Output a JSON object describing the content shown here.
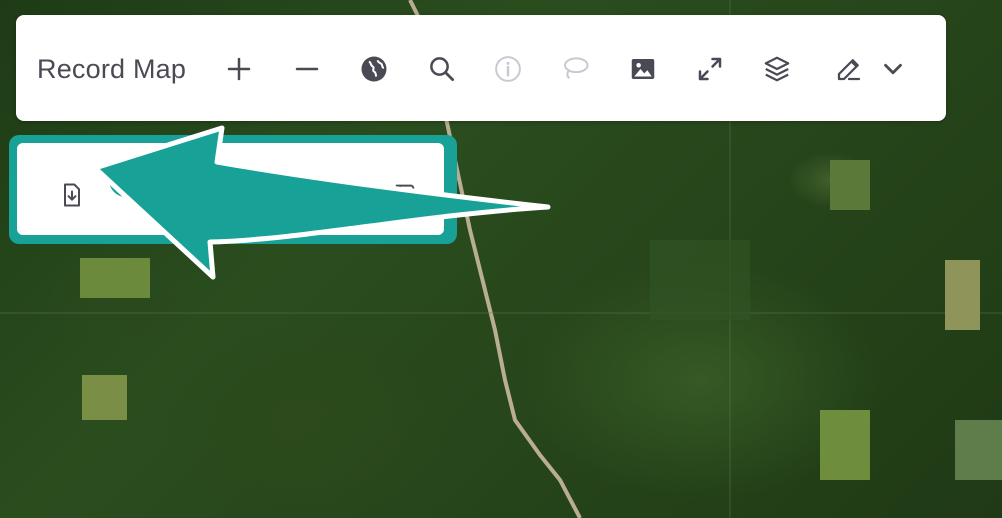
{
  "toolbar": {
    "title": "Record Map",
    "buttons": [
      {
        "name": "zoom-in",
        "icon": "plus-icon",
        "enabled": true
      },
      {
        "name": "zoom-out",
        "icon": "minus-icon",
        "enabled": true
      },
      {
        "name": "globe",
        "icon": "globe-icon",
        "enabled": true
      },
      {
        "name": "search",
        "icon": "search-icon",
        "enabled": true
      },
      {
        "name": "info",
        "icon": "info-icon",
        "enabled": false
      },
      {
        "name": "lasso",
        "icon": "lasso-icon",
        "enabled": false
      },
      {
        "name": "image",
        "icon": "image-icon",
        "enabled": true
      },
      {
        "name": "fullscreen",
        "icon": "expand-icon",
        "enabled": true
      },
      {
        "name": "layers",
        "icon": "layers-icon",
        "enabled": true
      },
      {
        "name": "edit",
        "icon": "pencil-icon",
        "enabled": true
      },
      {
        "name": "more",
        "icon": "chevron-down-icon",
        "enabled": true
      }
    ]
  },
  "sub_panel": {
    "buttons": [
      {
        "name": "download",
        "icon": "file-download-icon",
        "enabled": true
      },
      {
        "name": "copy",
        "icon": "copy-icon",
        "enabled": true
      },
      {
        "name": "thumbs-up",
        "icon": "thumbs-up-icon",
        "enabled": false
      },
      {
        "name": "thumbs-down",
        "icon": "thumbs-down-icon",
        "enabled": true
      }
    ]
  },
  "colors": {
    "highlight": "#18a196",
    "icon": "#4a4a55",
    "icon_disabled": "#c9c9d3",
    "toolbar_bg": "#ffffff"
  }
}
